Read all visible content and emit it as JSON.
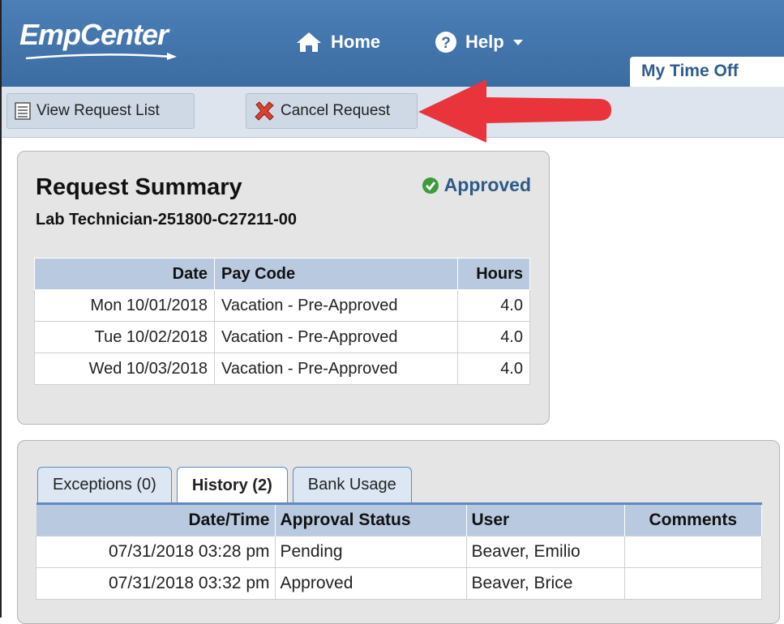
{
  "header": {
    "logo": "EmpCenter",
    "nav": {
      "home": "Home",
      "help": "Help"
    },
    "tab": "My Time Off"
  },
  "toolbar": {
    "view_request_list": "View Request List",
    "cancel_request": "Cancel Request"
  },
  "summary": {
    "title": "Request Summary",
    "subtitle": "Lab Technician-251800-C27211-00",
    "status": "Approved",
    "columns": {
      "date": "Date",
      "pay_code": "Pay Code",
      "hours": "Hours"
    },
    "rows": [
      {
        "date": "Mon 10/01/2018",
        "pay_code": "Vacation - Pre-Approved",
        "hours": "4.0"
      },
      {
        "date": "Tue 10/02/2018",
        "pay_code": "Vacation - Pre-Approved",
        "hours": "4.0"
      },
      {
        "date": "Wed 10/03/2018",
        "pay_code": "Vacation - Pre-Approved",
        "hours": "4.0"
      }
    ]
  },
  "history": {
    "tabs": [
      "Exceptions (0)",
      "History (2)",
      "Bank Usage"
    ],
    "active_tab": "History (2)",
    "columns": {
      "datetime": "Date/Time",
      "status": "Approval Status",
      "user": "User",
      "comments": "Comments"
    },
    "rows": [
      {
        "datetime": "07/31/2018 03:28 pm",
        "status": "Pending",
        "user": "Beaver, Emilio",
        "comments": ""
      },
      {
        "datetime": "07/31/2018 03:32 pm",
        "status": "Approved",
        "user": "Beaver, Brice",
        "comments": ""
      }
    ]
  },
  "colors": {
    "header": "#3b6ca2",
    "accent": "#2d5a87",
    "approved": "#3a9d3a",
    "arrow": "#e8343a"
  }
}
